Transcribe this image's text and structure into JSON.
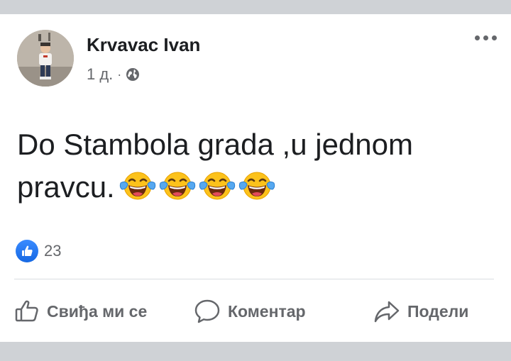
{
  "post": {
    "author": "Krvavac Ivan",
    "time": "1 д.",
    "separator": "·",
    "text": "Do Stambola grada ,u jednom pravcu.",
    "emojis": [
      "face-with-tears-of-joy-icon",
      "face-with-tears-of-joy-icon",
      "face-with-tears-of-joy-icon",
      "face-with-tears-of-joy-icon"
    ],
    "reaction_count": "23"
  },
  "actions": {
    "like_label": "Свиђа ми се",
    "comment_label": "Коментар",
    "share_label": "Подели"
  },
  "colors": {
    "text": "#1c1e21",
    "muted": "#65676b",
    "like_blue": "#1877f2",
    "background": "#cfd2d6",
    "card": "#ffffff"
  }
}
